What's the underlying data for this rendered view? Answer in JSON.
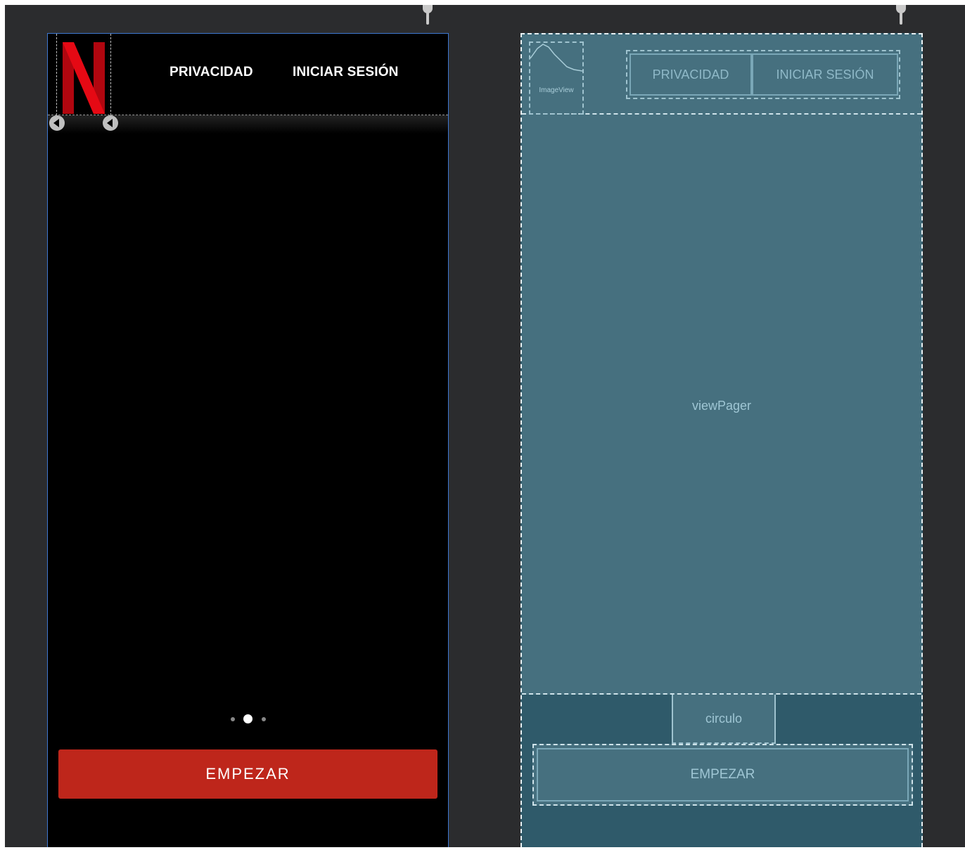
{
  "design": {
    "links": {
      "privacy": "PRIVACIDAD",
      "login": "INICIAR SESIÓN"
    },
    "start_button": "EMPEZAR",
    "pager_dots": {
      "count": 3,
      "active_index": 1
    },
    "logo_color": "#e50914",
    "accent_color": "#be261b"
  },
  "blueprint": {
    "image_label": "ImageView",
    "links": {
      "privacy": "PRIVACIDAD",
      "login": "INICIAR SESIÓN"
    },
    "pager_label": "viewPager",
    "circle_label": "circulo",
    "start_button": "EMPEZAR"
  }
}
